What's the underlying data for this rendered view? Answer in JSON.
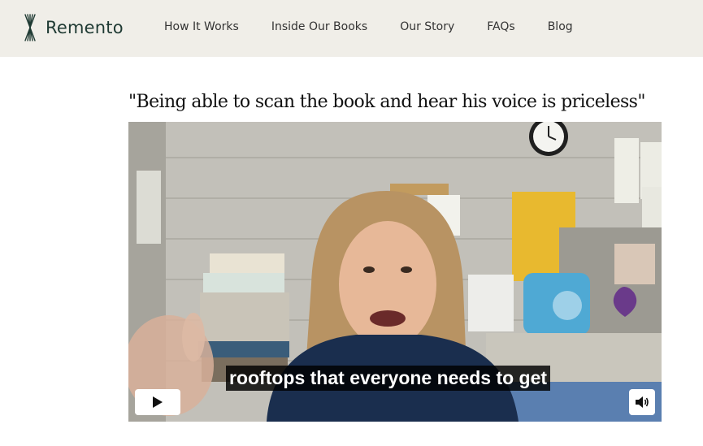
{
  "header": {
    "brand": "Remento",
    "nav": [
      {
        "label": "How It Works"
      },
      {
        "label": "Inside Our Books"
      },
      {
        "label": "Our Story"
      },
      {
        "label": "FAQs"
      },
      {
        "label": "Blog"
      }
    ]
  },
  "testimonial": {
    "quote": "\"Being able to scan the book and hear his voice is priceless\""
  },
  "video": {
    "caption": "rooftops that everyone needs to get",
    "play_icon": "play-icon",
    "volume_icon": "volume-icon"
  },
  "colors": {
    "header_bg": "#f0eee8",
    "brand": "#1f3a33"
  }
}
